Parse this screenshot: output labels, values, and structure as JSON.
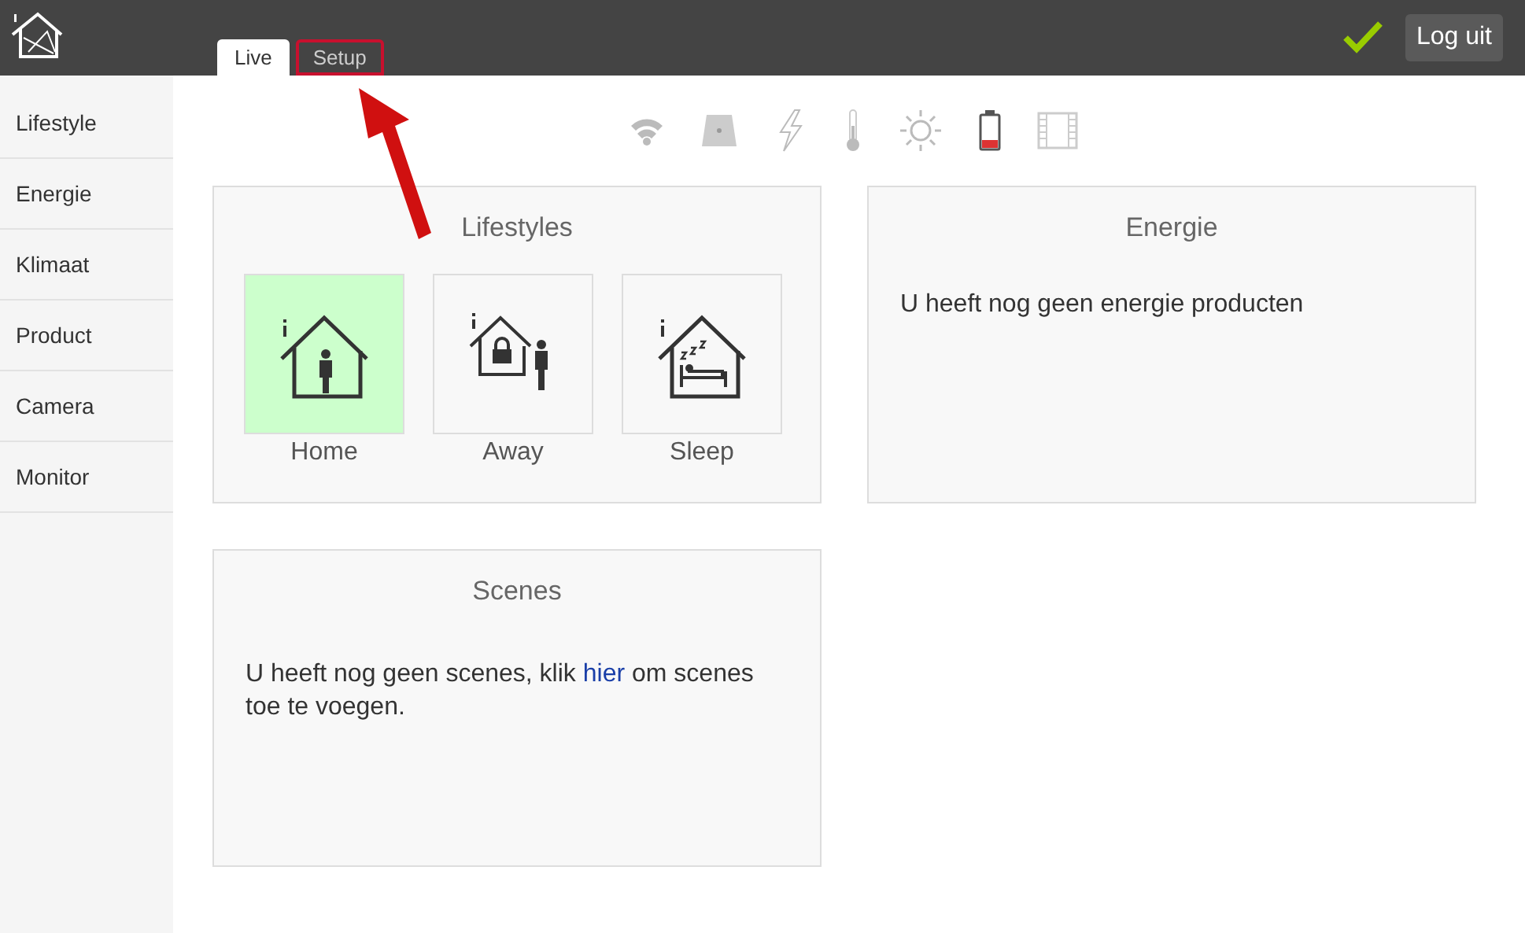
{
  "header": {
    "logout": "Log uit",
    "connected": true
  },
  "tabs": [
    {
      "label": "Live",
      "selected": true,
      "highlighted": false
    },
    {
      "label": "Setup",
      "selected": false,
      "highlighted": true
    }
  ],
  "sidebar": {
    "items": [
      {
        "label": "Lifestyle"
      },
      {
        "label": "Energie"
      },
      {
        "label": "Klimaat"
      },
      {
        "label": "Product"
      },
      {
        "label": "Camera"
      },
      {
        "label": "Monitor"
      }
    ]
  },
  "lifestyles": {
    "title": "Lifestyles",
    "items": [
      {
        "label": "Home",
        "kind": "home",
        "selected": true
      },
      {
        "label": "Away",
        "kind": "away",
        "selected": false
      },
      {
        "label": "Sleep",
        "kind": "sleep",
        "selected": false
      }
    ]
  },
  "energie": {
    "title": "Energie",
    "message": "U heeft nog geen energie producten"
  },
  "scenes": {
    "title": "Scenes",
    "before": "U heeft nog geen scenes, klik",
    "link": "hier",
    "after": "om scenes toe te voegen."
  }
}
